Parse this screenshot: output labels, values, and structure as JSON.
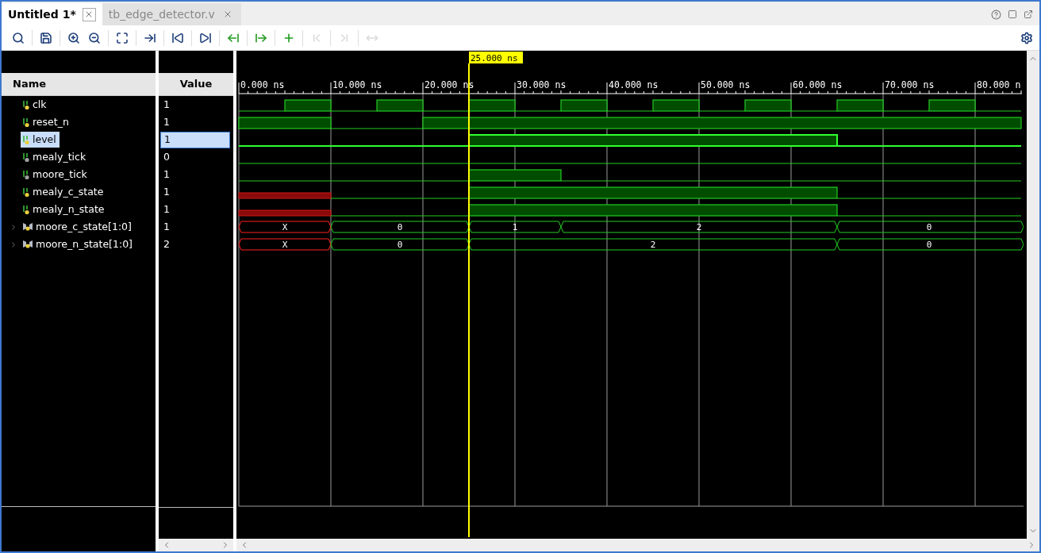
{
  "tabs": [
    {
      "label": "Untitled 1*",
      "selected": true
    },
    {
      "label": "tb_edge_detector.v",
      "selected": false
    }
  ],
  "toolbar": [
    {
      "kind": "search",
      "disabled": false
    },
    {
      "kind": "save",
      "disabled": false
    },
    {
      "kind": "zoom-in",
      "disabled": false
    },
    {
      "kind": "zoom-out",
      "disabled": false
    },
    {
      "kind": "zoom-fit",
      "disabled": false
    },
    {
      "kind": "go-cursor",
      "disabled": false
    },
    {
      "kind": "go-start",
      "disabled": false
    },
    {
      "kind": "go-end",
      "disabled": false
    },
    {
      "kind": "prev-edge",
      "disabled": false
    },
    {
      "kind": "next-edge",
      "disabled": false
    },
    {
      "kind": "add-marker",
      "disabled": false
    },
    {
      "kind": "prev-marker",
      "disabled": true
    },
    {
      "kind": "next-marker",
      "disabled": true
    },
    {
      "kind": "swap",
      "disabled": true
    }
  ],
  "columns": {
    "name": "Name",
    "value": "Value"
  },
  "cursor": {
    "time": "25.000 ns"
  },
  "ruler": [
    "0.000 ns",
    "10.000 ns",
    "20.000 ns",
    "30.000 ns",
    "40.000 ns",
    "50.000 ns",
    "60.000 ns",
    "70.000 ns",
    "80.000 n"
  ],
  "signals": [
    {
      "name": "clk",
      "value": "1",
      "kind": "bit",
      "selected": false,
      "color": "#e8d040"
    },
    {
      "name": "reset_n",
      "value": "1",
      "kind": "bit",
      "selected": false,
      "color": "#e8d040"
    },
    {
      "name": "level",
      "value": "1",
      "kind": "bit",
      "selected": true,
      "color": "#e8d040"
    },
    {
      "name": "mealy_tick",
      "value": "0",
      "kind": "bit",
      "selected": false,
      "color": "#a0a0a0"
    },
    {
      "name": "moore_tick",
      "value": "1",
      "kind": "bit",
      "selected": false,
      "color": "#a0a0a0"
    },
    {
      "name": "mealy_c_state",
      "value": "1",
      "kind": "bit",
      "selected": false,
      "color": "#e8d040"
    },
    {
      "name": "mealy_n_state",
      "value": "1",
      "kind": "bit",
      "selected": false,
      "color": "#e8d040"
    },
    {
      "name": "moore_c_state[1:0]",
      "value": "1",
      "kind": "bus",
      "selected": false,
      "color": "#e8d040",
      "expanded": false,
      "segments": [
        "X",
        "0",
        "1",
        "2",
        "0"
      ]
    },
    {
      "name": "moore_n_state[1:0]",
      "value": "2",
      "kind": "bus",
      "selected": false,
      "color": "#e8d040",
      "expanded": false,
      "segments": [
        "X",
        "0",
        "2",
        "0"
      ]
    }
  ]
}
